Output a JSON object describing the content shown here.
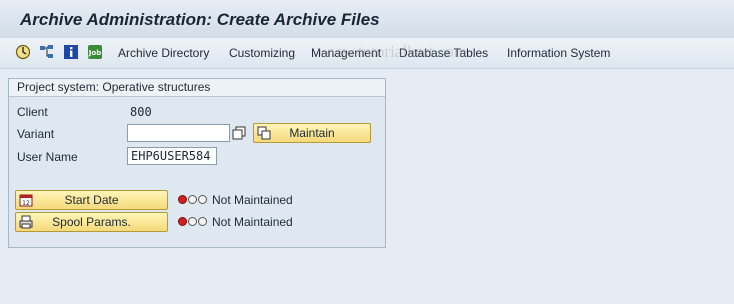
{
  "window": {
    "title": "Archive Administration: Create Archive Files"
  },
  "toolbar": {
    "icons": [
      "execute-icon",
      "hierarchy-icon",
      "info-icon",
      "job-icon"
    ],
    "menu": [
      "Archive Directory",
      "Customizing",
      "Management",
      "Database Tables",
      "Information System"
    ]
  },
  "watermark": "www.tutorialkart.com",
  "group": {
    "title": "Project system: Operative structures",
    "client_label": "Client",
    "client_value": "800",
    "variant_label": "Variant",
    "variant_value": "",
    "maintain_label": "Maintain",
    "username_label": "User Name",
    "username_value": "EHP6USER584",
    "start_date_label": "Start Date",
    "start_date_status": "Not Maintained",
    "spool_label": "Spool Params.",
    "spool_status": "Not Maintained"
  },
  "colors": {
    "accent_button": "#f5d97a",
    "status_red": "#d41f1f"
  }
}
